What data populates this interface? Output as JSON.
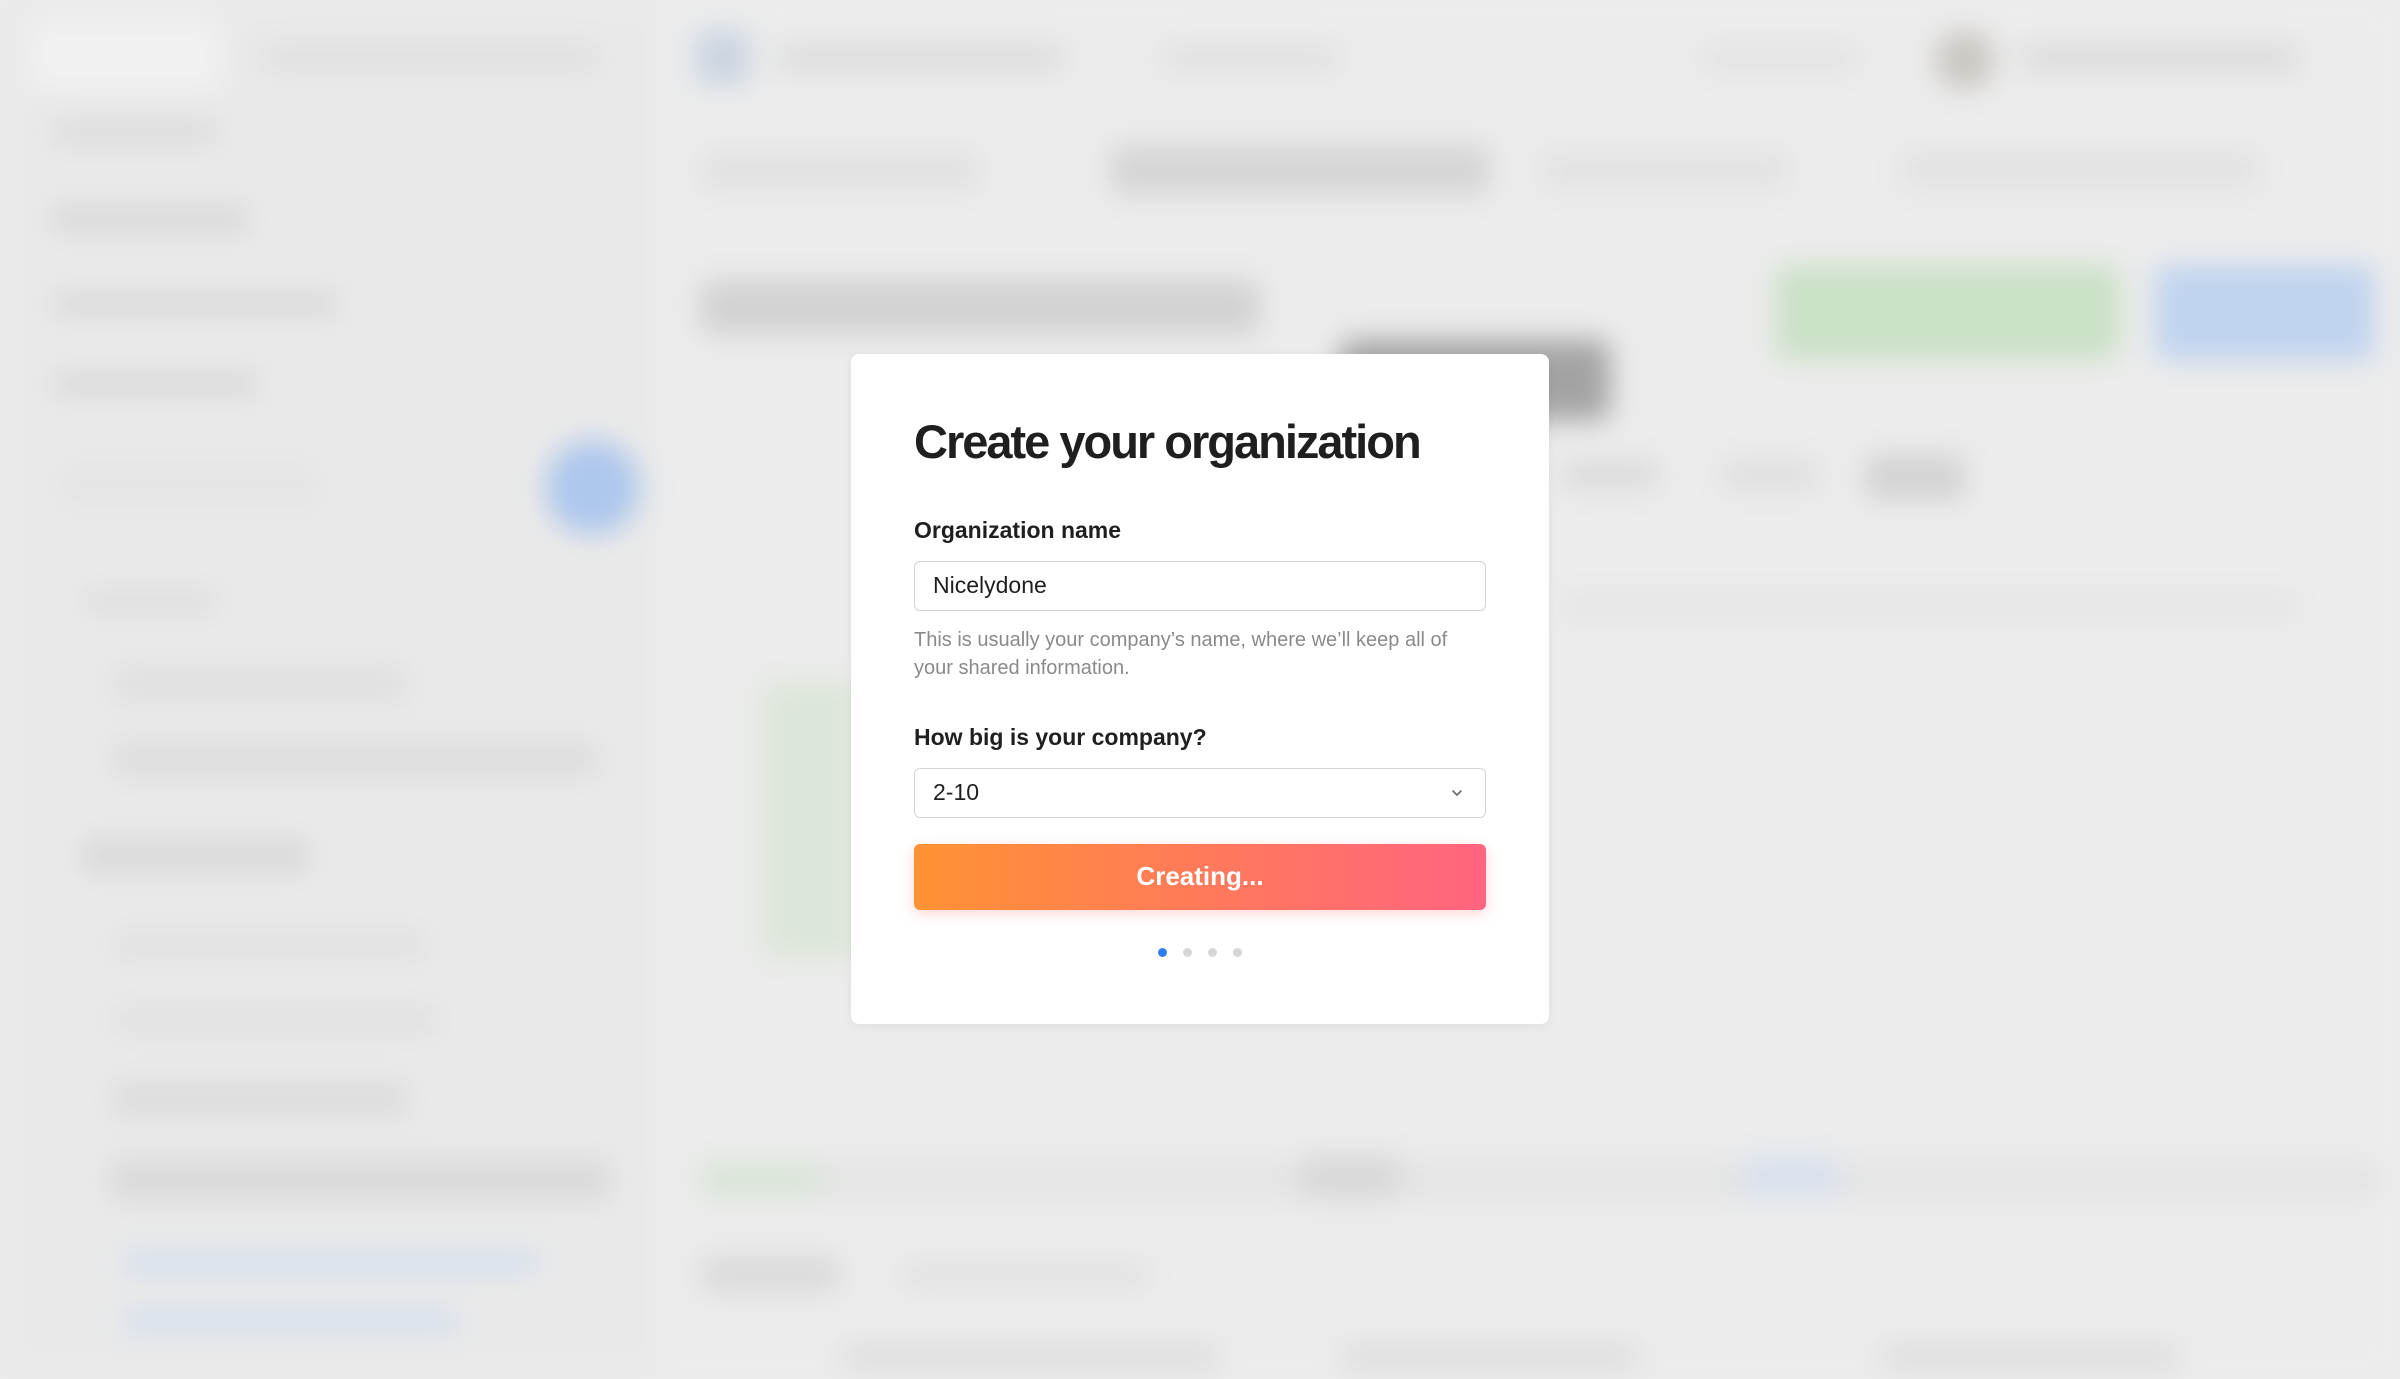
{
  "modal": {
    "title": "Create your organization",
    "org_name": {
      "label": "Organization name",
      "value": "Nicelydone",
      "help": "This is usually your company’s name, where we’ll keep all of your shared information."
    },
    "company_size": {
      "label": "How big is your company?",
      "selected": "2-10",
      "icon": "chevron-down-icon"
    },
    "submit_label": "Creating...",
    "steps": {
      "current": 1,
      "total": 4
    }
  },
  "colors": {
    "button_gradient_start": "#ff9233",
    "button_gradient_end": "#ff6480",
    "active_step": "#2f7fe8",
    "inactive_step": "#d6d6d6"
  }
}
